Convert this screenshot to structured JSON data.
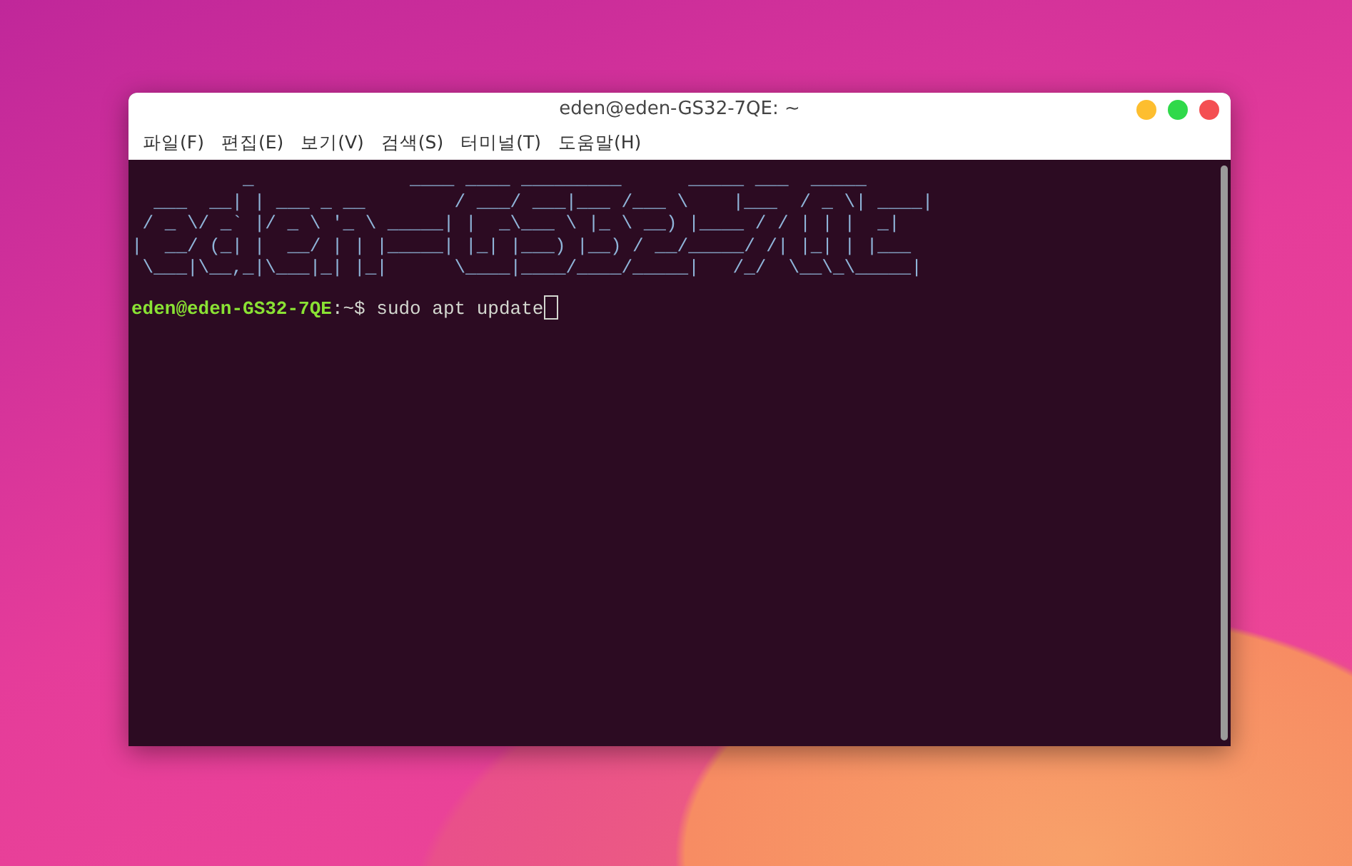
{
  "window": {
    "title": "eden@eden-GS32-7QE: ~"
  },
  "menu": [
    "파일(F)",
    "편집(E)",
    "보기(V)",
    "검색(S)",
    "터미널(T)",
    "도움말(H)"
  ],
  "terminal": {
    "banner": "          _              ____ ____ _________      _____ ___  _____\n  ___  __| | ___ _ __        / ___/ ___|___ /___ \\    |___  / _ \\| ____|\n / _ \\/ _` |/ _ \\ '_ \\ _____| |  _\\___ \\ |_ \\ __) |____ / / | | |  _|\n|  __/ (_| |  __/ | | |_____| |_| |___) |__) / __/_____/ /| |_| | |___\n \\___|\\__,_|\\___|_| |_|      \\____|____/____/_____|   /_/  \\__\\_\\_____|",
    "prompt": {
      "user_host": "eden@eden-GS32-7QE",
      "path": ":~$"
    },
    "command": "sudo apt update"
  }
}
